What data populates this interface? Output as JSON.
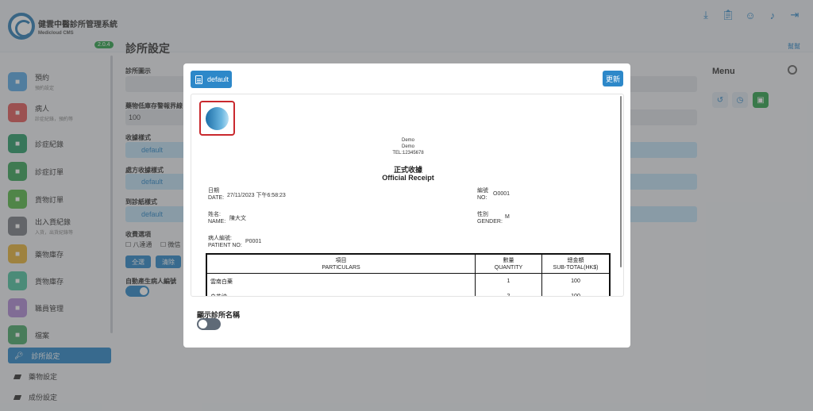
{
  "app": {
    "title": "健雲中醫診所管理系統",
    "subtitle": "Medicloud CMS",
    "version": "2.0.4"
  },
  "header_icons": [
    "download-icon",
    "clipboard-icon",
    "user-icon",
    "bell-icon",
    "logout-icon"
  ],
  "sidebar": {
    "items": [
      {
        "label": "預約",
        "sub": "預約設定",
        "color": "#5aa9e6"
      },
      {
        "label": "病人",
        "sub": "診症紀錄，預約等",
        "color": "#e05a5a"
      },
      {
        "label": "診症紀錄",
        "sub": "",
        "color": "#2a9d6a"
      },
      {
        "label": "診症訂單",
        "sub": "",
        "color": "#3aa55a"
      },
      {
        "label": "貨物訂單",
        "sub": "",
        "color": "#58b84a"
      },
      {
        "label": "出入貨紀錄",
        "sub": "入貨，出貨紀錄等",
        "color": "#7a7f86"
      },
      {
        "label": "藥物庫存",
        "sub": "",
        "color": "#e6b23a"
      },
      {
        "label": "貨物庫存",
        "sub": "",
        "color": "#4fc3a0"
      },
      {
        "label": "職員管理",
        "sub": "",
        "color": "#b08ad6"
      },
      {
        "label": "檔案",
        "sub": "",
        "color": "#4aa86a"
      }
    ],
    "active": "診所設定",
    "more": [
      "藥物設定",
      "成份設定"
    ]
  },
  "page": {
    "title": "診所設定",
    "help": "幫幫",
    "labels": {
      "clinic_display": "診所圖示",
      "low_stock": "藥物低庫存警報界線",
      "low_stock_value": "100",
      "receipt_style": "收據樣式",
      "prescription_style": "處方收據樣式",
      "referral_style": "到診紙樣式",
      "fee_options": "收費選項",
      "fee_opt1": "八達通",
      "fee_opt2": "微信",
      "select_all": "全選",
      "clear": "清除",
      "auto_patient_no": "自動產生病人編號"
    },
    "default_value": "default",
    "menu_title": "Menu"
  },
  "modal": {
    "template": "default",
    "update": "更新",
    "clinic": {
      "name": "Demo",
      "name2": "Demo",
      "tel": "TEL:12345678"
    },
    "receipt_title_zh": "正式收據",
    "receipt_title_en": "Official Receipt",
    "fields": {
      "date_label_zh": "日期",
      "date_label_en": "DATE:",
      "date_value": "27/11/2023 下午6:58:23",
      "no_label_zh": "編號",
      "no_label_en": "NO:",
      "no_value": "O0001",
      "name_label_zh": "姓名:",
      "name_label_en": "NAME:",
      "name_value": "陳大文",
      "gender_label_zh": "性別",
      "gender_label_en": "GENDER:",
      "gender_value": "M",
      "patient_label_zh": "病人編號:",
      "patient_label_en": "PATIENT NO:",
      "patient_value": "P0001"
    },
    "table": {
      "headers": [
        {
          "zh": "項目",
          "en": "PARTICULARS"
        },
        {
          "zh": "數量",
          "en": "QUANTITY"
        },
        {
          "zh": "總金額",
          "en": "SUB-TOTAL(HK$)"
        }
      ],
      "rows": [
        {
          "item": "雲南白藥",
          "qty": "1",
          "total": "100"
        },
        {
          "item": "白花油",
          "qty": "2",
          "total": "100"
        }
      ]
    },
    "show_clinic_name": "顯示診所名稱",
    "show_clinic_name_on": false
  }
}
